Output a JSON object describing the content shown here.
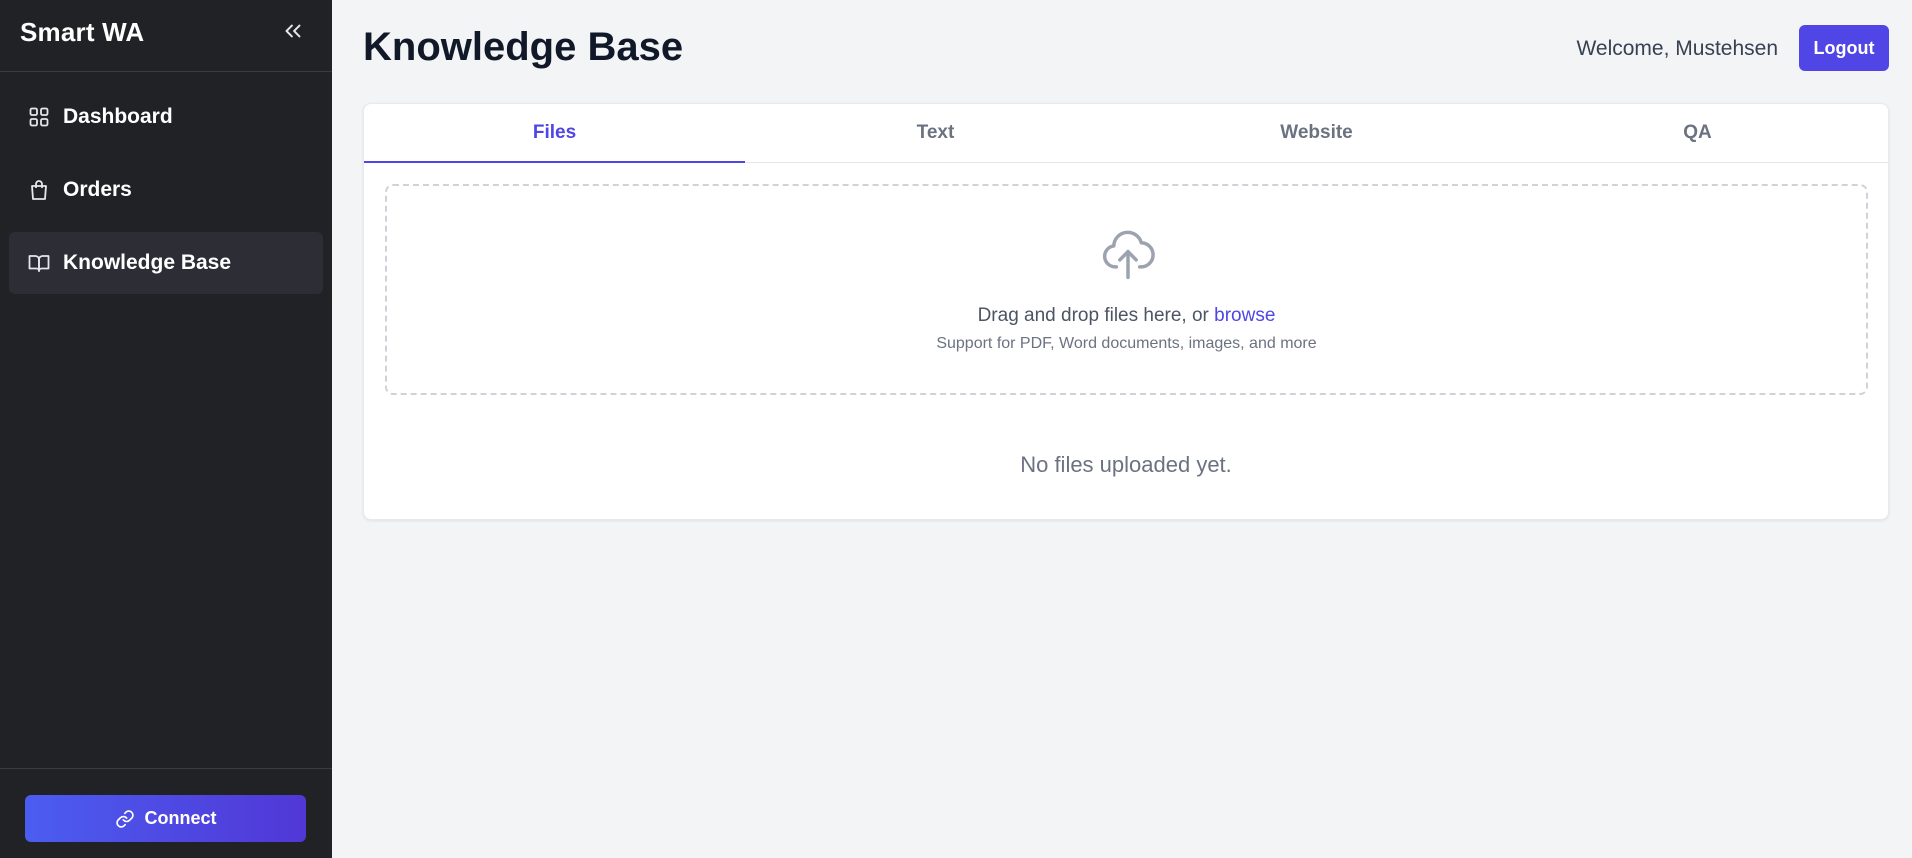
{
  "app": {
    "brand": "Smart WA"
  },
  "sidebar": {
    "items": [
      {
        "label": "Dashboard",
        "icon": "grid-icon"
      },
      {
        "label": "Orders",
        "icon": "shopping-bag-icon"
      },
      {
        "label": "Knowledge Base",
        "icon": "book-icon",
        "active": true
      }
    ],
    "connect_label": "Connect"
  },
  "header": {
    "title": "Knowledge Base",
    "welcome": "Welcome, Mustehsen",
    "logout_label": "Logout"
  },
  "tabs": [
    "Files",
    "Text",
    "Website",
    "QA"
  ],
  "active_tab": "Files",
  "upload": {
    "prompt": "Drag and drop files here, or ",
    "browse": "browse",
    "support": "Support for PDF, Word documents, images, and more"
  },
  "empty_state": "No files uploaded yet.",
  "colors": {
    "accent": "#4f46e5",
    "sidebar_bg": "#212226",
    "page_bg": "#f3f4f6"
  }
}
